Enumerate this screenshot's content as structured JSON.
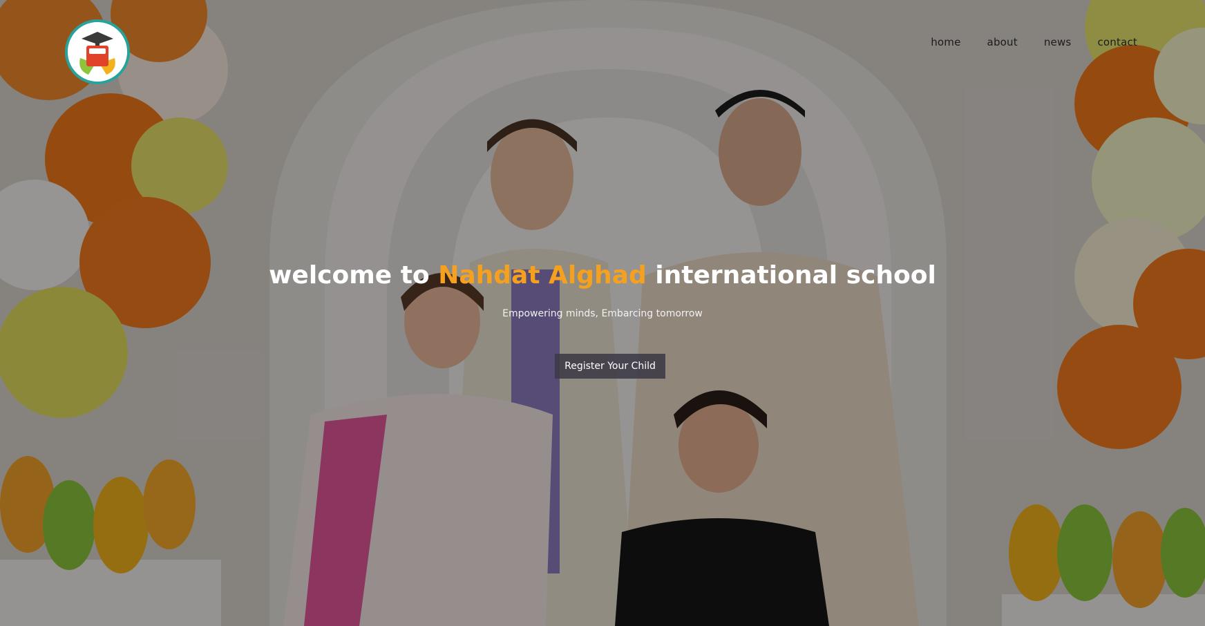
{
  "brand": {
    "logo_alt": "Nahdat Alghad international school logo"
  },
  "nav": {
    "items": [
      {
        "label": "home"
      },
      {
        "label": "about"
      },
      {
        "label": "news"
      },
      {
        "label": "contact"
      }
    ]
  },
  "hero": {
    "headline_prefix": "welcome to",
    "headline_highlight": "Nahdat Alghad",
    "headline_suffix": "international school",
    "subtitle": "Empowering minds, Embarcing tomorrow",
    "cta_label": "Register Your Child"
  },
  "colors": {
    "accent": "#f5a01e",
    "logo_ring": "#27a39c",
    "button_bg": "#3c3a46"
  }
}
